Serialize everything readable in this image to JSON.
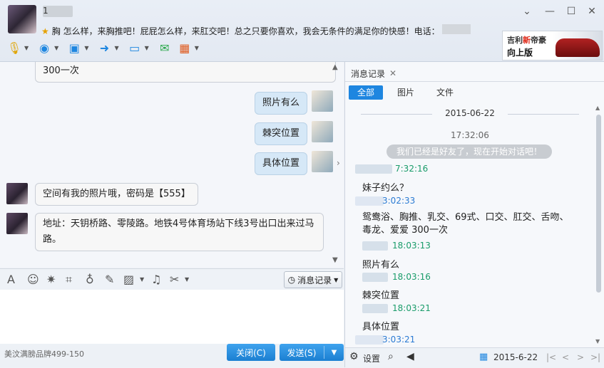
{
  "header": {
    "nickname_visible": "1",
    "signature": "胸 怎么样，来胸推吧！屁屁怎么样，来肛交吧！总之只要你喜欢，我会无条件的满足你的快感！电话：",
    "window_controls": [
      "chevron-down-icon",
      "minimize-icon",
      "maximize-icon",
      "close-icon"
    ],
    "ad": {
      "line1_a": "吉利",
      "line1_b": "新",
      "line1_c": "帝豪",
      "line2": "向上版"
    }
  },
  "toolbar": {
    "items": [
      {
        "icon": "microphone-icon",
        "glyph": "🎙"
      },
      {
        "icon": "camera-icon",
        "glyph": "◉"
      },
      {
        "icon": "screen-share-icon",
        "glyph": "▣"
      },
      {
        "icon": "file-transfer-icon",
        "glyph": "➜"
      },
      {
        "icon": "remote-desktop-icon",
        "glyph": "▭"
      },
      {
        "icon": "message-add-icon",
        "glyph": "✉"
      },
      {
        "icon": "apps-icon",
        "glyph": "▦"
      }
    ]
  },
  "chat": {
    "messages": [
      {
        "side": "left",
        "text": "300一次"
      },
      {
        "side": "right",
        "text": "照片有么"
      },
      {
        "side": "right",
        "text": "棘突位置"
      },
      {
        "side": "right",
        "text": "具体位置"
      },
      {
        "side": "left",
        "text": "空间有我的照片哦，密码是【555】"
      },
      {
        "side": "left",
        "text": "地址：天钥桥路、零陵路。地铁4号体育场站下线3号出口出来过马路。"
      }
    ]
  },
  "input_toolbar": {
    "icons": [
      "font-icon",
      "emoji-icon",
      "nudge-icon",
      "screenshot-icon",
      "voice-icon",
      "edit-icon",
      "image-icon",
      "music-icon",
      "scissors-icon"
    ],
    "message_record_label": "消息记录"
  },
  "footer": {
    "brand": "美汶满膀品牌499-150",
    "close_label": "关闭(C)",
    "send_label": "发送(S)"
  },
  "history": {
    "tab_label": "消息记录",
    "filters": [
      "全部",
      "图片",
      "文件"
    ],
    "date": "2015-06-22",
    "session_time": "17:32:06",
    "system_message": "我们已经是好友了，现在开始对话吧！",
    "entries": [
      {
        "time": "7:32:16",
        "text": "妹子约么？",
        "color": "green"
      },
      {
        "time": "3:02:33",
        "text": "鸳鸯浴、胸推、乳交、69式、口交、肛交、舌吻、毒龙、爱爱 300一次",
        "color": "blue"
      },
      {
        "time": "18:03:13",
        "text": "照片有么",
        "color": "green"
      },
      {
        "time": "18:03:16",
        "text": "棘突位置",
        "color": "green"
      },
      {
        "time": "18:03:21",
        "text": "具体位置",
        "color": "green"
      },
      {
        "time": "3:03:21",
        "text": "",
        "color": "blue"
      }
    ],
    "footer": {
      "settings_label": "设置",
      "date_value": "2015-6-22"
    }
  }
}
